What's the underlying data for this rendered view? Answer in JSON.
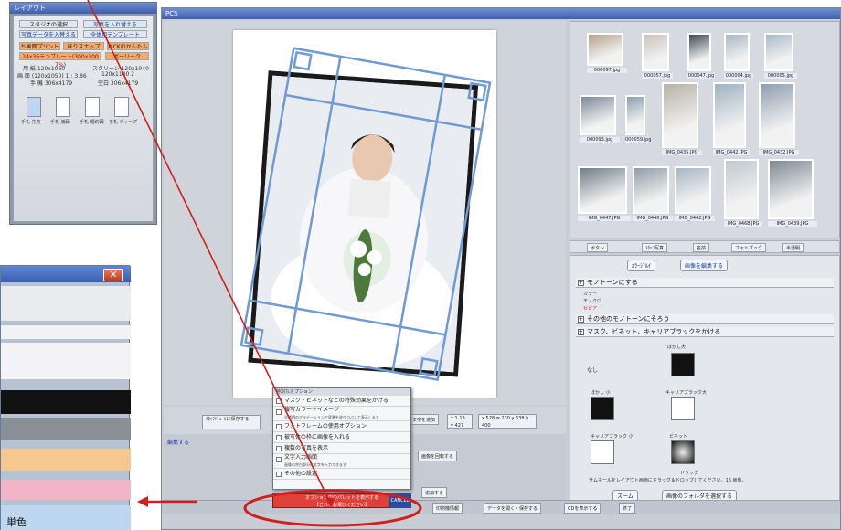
{
  "colors": {
    "accent_red": "#c8102e",
    "sepia": "#e21d1d",
    "blue_title": "#3f5fae",
    "callout": "#d01f1f"
  },
  "left_panel": {
    "title": "レイアウト",
    "row1_left": "スタジオの選択",
    "row1_right": "写真を入れ替える",
    "row2_left": "写真データを入替える",
    "row2_right": "全体用テンプレート",
    "row3_a": "ち画面プリント",
    "row3_b": "ほりスナップ",
    "row3_c": "PICKのかんたん",
    "row4_left": "24x36テンプレート(300x300 7%)",
    "row4_right": "ボーリーク",
    "info1": "用 紙 120x1060",
    "info2": "スクリーン 120x1040",
    "info3": "画 面 (120x1050) 1 : 3.86",
    "info4": "120x1140 2",
    "info5": "手 機 306x4179",
    "info6": "空白 306x4179",
    "thumb_labels": [
      "手札 先方",
      "手札 補図",
      "手札 婚約図",
      "手札 ディープ"
    ]
  },
  "main": {
    "title": "PCS",
    "thumbs": {
      "labels": [
        "000097.jpg",
        "000057.jpg",
        "000047.jpg",
        "000004.jpg",
        "000005.jpg",
        "000093.jpg",
        "000059.jpg",
        "IMG_0435.JPG",
        "IMG_0442.JPG",
        "IMG_0432.JPG",
        "IMG_0447.JPG",
        "IMG_0440.JPG",
        "IMG_0442.JPG",
        "IMG_0468.JPG",
        "IMG_0439.JPG"
      ]
    },
    "tabs": [
      "ボタン",
      "ｽﾀｯﾌ写真",
      "名前",
      "フォトブック",
      "半透明"
    ],
    "opts": {
      "btn_a": "ｶﾗｰｼﾞﾙｲ",
      "btn_b": "画像を編集する",
      "sec1": "モノトーンにする",
      "r1": "カラー",
      "r2": "モノクロ",
      "r3": "セピア",
      "sec2": "その他のモノトーンにそろう",
      "sec3": "マスク、ビネット、キャリアブラックをかける",
      "none": "なし",
      "mask_labels": [
        "ぼかし大",
        "ぼかし 小",
        "キャリアブラック大",
        "キャリアブラック 小",
        "ビネット"
      ],
      "footnote1": "ドラッグ",
      "footnote2": "サムネールをレイアウト画面にドラッグ＆ドロップしてください。16 画像。",
      "btn_zoom": "ズーム",
      "btn_select": "画像のフォルダを選択する"
    },
    "bottom": {
      "b1": "ｽﾀｯﾌｼﾞｭｰﾙに保存する",
      "b2": "文字を追加",
      "b3": "x 1.18 y 427",
      "b4": "x 528 w 230 y 638 h 400",
      "edit": "編集する",
      "rotate": "画像を回転する",
      "add": "追加する"
    },
    "status": {
      "print_setting": "印刷機情報",
      "save": "データを開く・保存する",
      "exit_mode": "CDを表示する",
      "close": "終了"
    },
    "menu": {
      "head": "特別なオプション",
      "items": [
        {
          "label": "マスク・ビネットなどの特殊効果をかける",
          "sub": ""
        },
        {
          "label": "複写カラー＋イメージ",
          "sub": "半透明のグラデーションで背景を塗りつぶして表示します"
        },
        {
          "label": "フォトフレームの使用オプション",
          "sub": ""
        },
        {
          "label": "被写体の枠に画像を入れる",
          "sub": ""
        },
        {
          "label": "複数の写真を表示",
          "sub": ""
        },
        {
          "label": "文字入力画面",
          "sub": "画像の余白部分に文字を入力できます"
        },
        {
          "label": "その他の設定",
          "sub": ""
        }
      ],
      "red_line1": "オプション内のパレットを表示する",
      "red_line2": "【これをお選びください】",
      "cancel": "CANCEL"
    }
  },
  "dialog": {
    "mono_label": "単色"
  }
}
